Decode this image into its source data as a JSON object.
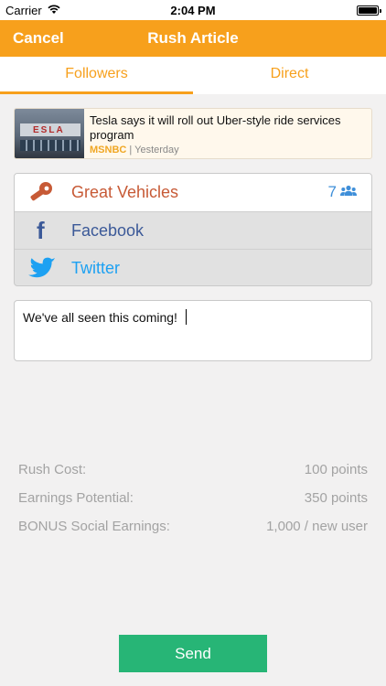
{
  "status": {
    "carrier": "Carrier",
    "time": "2:04 PM",
    "battery_level": 1.0
  },
  "nav": {
    "cancel_label": "Cancel",
    "title": "Rush Article"
  },
  "tabs": [
    {
      "label": "Followers",
      "active": true
    },
    {
      "label": "Direct",
      "active": false
    }
  ],
  "article": {
    "thumb_text": "ESLA",
    "headline": "Tesla says it will roll out Uber-style ride services program",
    "source": "MSNBC",
    "separator": " | ",
    "date": "Yesterday"
  },
  "targets": [
    {
      "label": "Great Vehicles",
      "count": "7",
      "icon": "car-part-icon",
      "color": "#c75a36"
    },
    {
      "label": "Facebook",
      "icon": "facebook-icon",
      "color": "#3b5998"
    },
    {
      "label": "Twitter",
      "icon": "twitter-icon",
      "color": "#1da1f2"
    }
  ],
  "comment": {
    "value": "We've all seen this coming!"
  },
  "stats": [
    {
      "label": "Rush Cost:",
      "value": "100 points"
    },
    {
      "label": "Earnings Potential:",
      "value": "350 points"
    },
    {
      "label": "BONUS Social Earnings:",
      "value": "1,000 / new user"
    }
  ],
  "send_label": "Send",
  "colors": {
    "accent": "#f7a01c",
    "send": "#27b576",
    "facebook": "#3b5998",
    "twitter": "#1da1f2"
  }
}
